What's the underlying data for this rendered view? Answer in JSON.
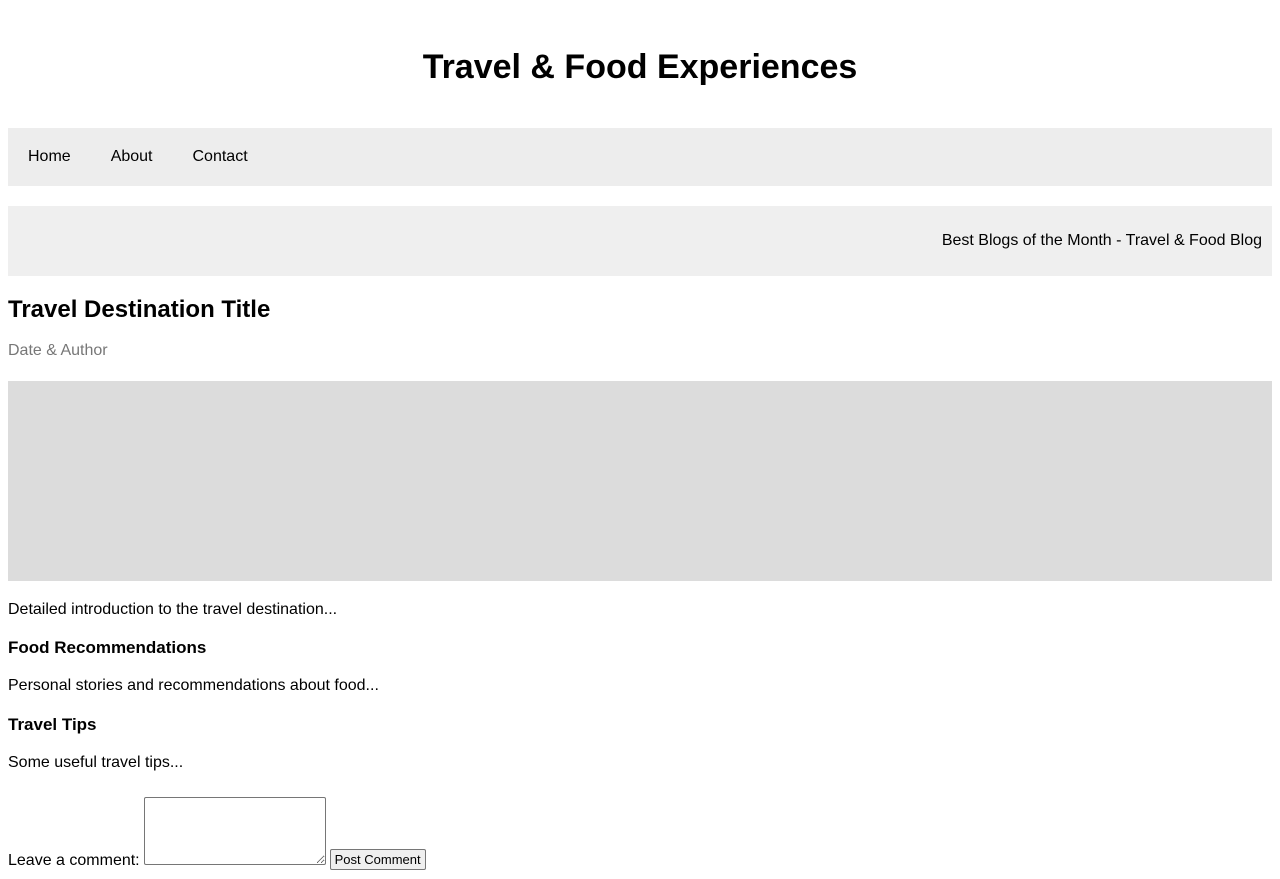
{
  "header": {
    "title": "Travel & Food Experiences"
  },
  "nav": {
    "items": [
      {
        "label": "Home"
      },
      {
        "label": "About"
      },
      {
        "label": "Contact"
      }
    ]
  },
  "banner": {
    "text": "Best Blogs of the Month - Travel & Food Blog"
  },
  "article": {
    "title": "Travel Destination Title",
    "meta": "Date & Author",
    "intro": "Detailed introduction to the travel destination...",
    "food": {
      "heading": "Food Recommendations",
      "text": "Personal stories and recommendations about food..."
    },
    "tips": {
      "heading": "Travel Tips",
      "text": "Some useful travel tips..."
    }
  },
  "comment": {
    "label": "Leave a comment:",
    "value": "",
    "button_label": "Post Comment"
  },
  "colors": {
    "nav_background": "#ededed",
    "banner_background": "#efefef",
    "image_placeholder": "#dcdcdc",
    "meta_text": "#777777"
  }
}
